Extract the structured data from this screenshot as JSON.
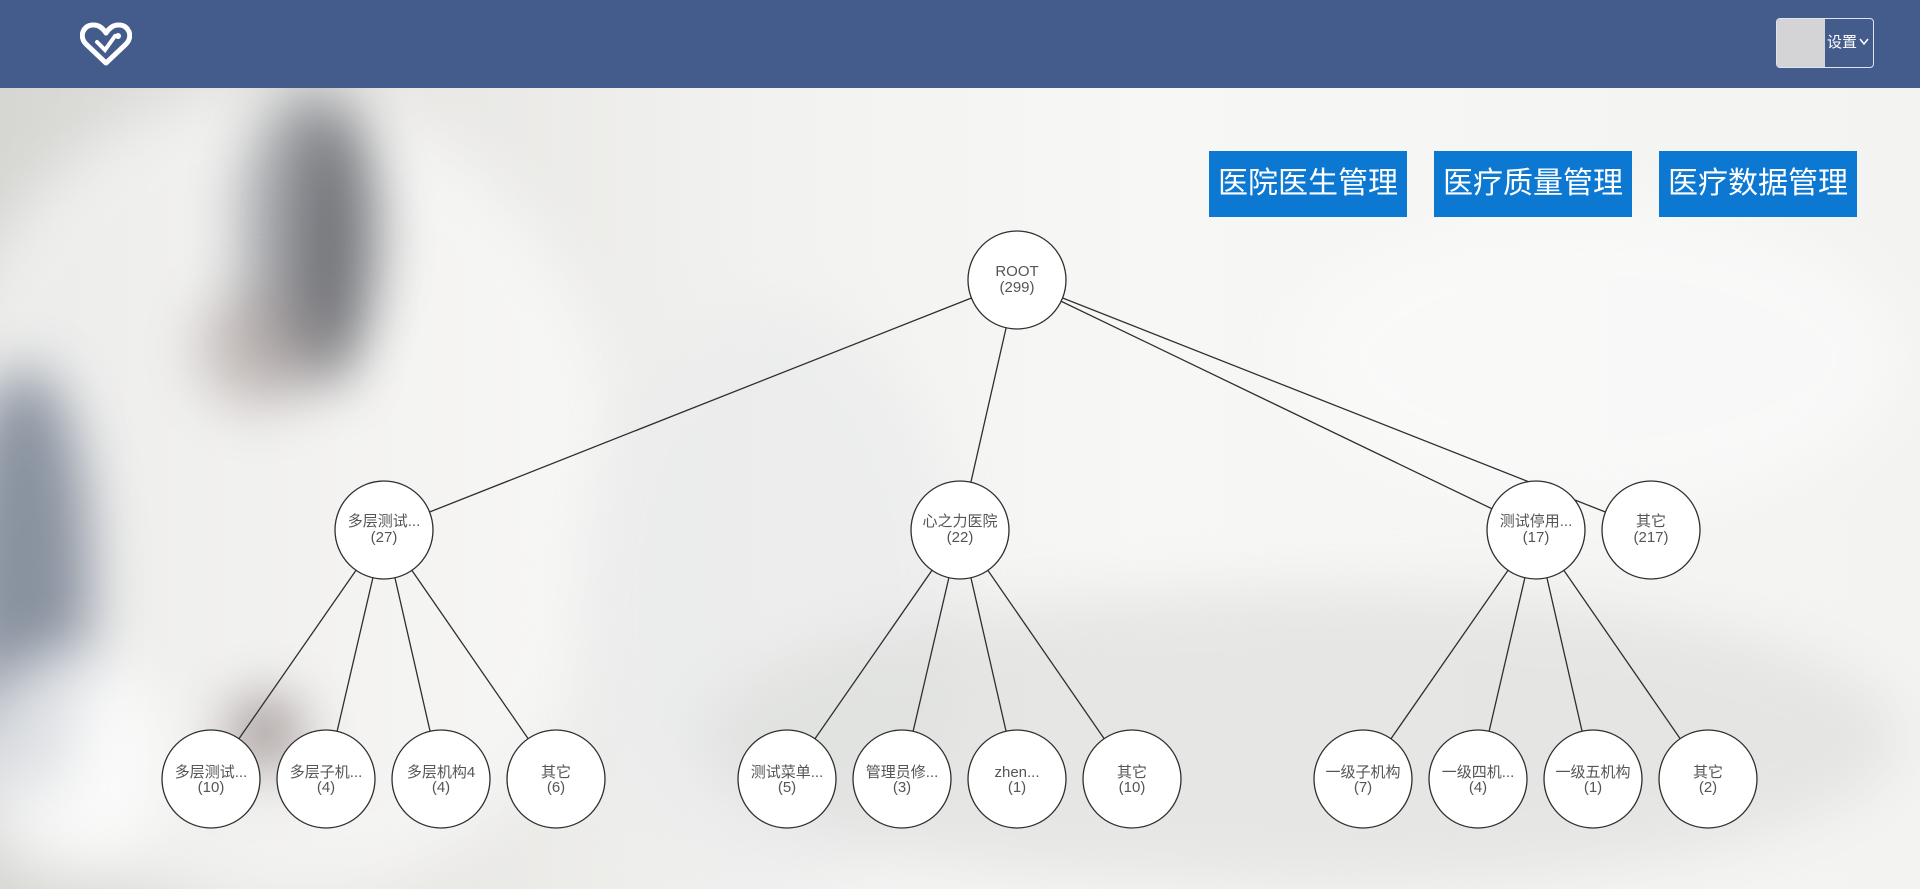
{
  "header": {
    "logo_icon": "heart-logo-icon",
    "settings": {
      "label": "设置",
      "icon": "chevron-down-icon"
    }
  },
  "nav_buttons": [
    {
      "label": "医院医生管理"
    },
    {
      "label": "医疗质量管理"
    },
    {
      "label": "医疗数据管理"
    }
  ],
  "tree": {
    "root": {
      "name": "ROOT",
      "count": "(299)"
    },
    "level1": [
      {
        "name": "多层测试...",
        "count": "(27)"
      },
      {
        "name": "心之力医院",
        "count": "(22)"
      },
      {
        "name": "测试停用...",
        "count": "(17)"
      },
      {
        "name": "其它",
        "count": "(217)"
      }
    ],
    "level2": [
      {
        "name": "多层测试...",
        "count": "(10)"
      },
      {
        "name": "多层子机...",
        "count": "(4)"
      },
      {
        "name": "多层机构4",
        "count": "(4)"
      },
      {
        "name": "其它",
        "count": "(6)"
      },
      {
        "name": "测试菜单...",
        "count": "(5)"
      },
      {
        "name": "管理员修...",
        "count": "(3)"
      },
      {
        "name": "zhen...",
        "count": "(1)"
      },
      {
        "name": "其它",
        "count": "(10)"
      },
      {
        "name": "一级子机构",
        "count": "(7)"
      },
      {
        "name": "一级四机...",
        "count": "(4)"
      },
      {
        "name": "一级五机构",
        "count": "(1)"
      },
      {
        "name": "其它",
        "count": "(2)"
      }
    ]
  },
  "colors": {
    "header_bg": "#445c8c",
    "button_bg": "#0c78d2"
  }
}
